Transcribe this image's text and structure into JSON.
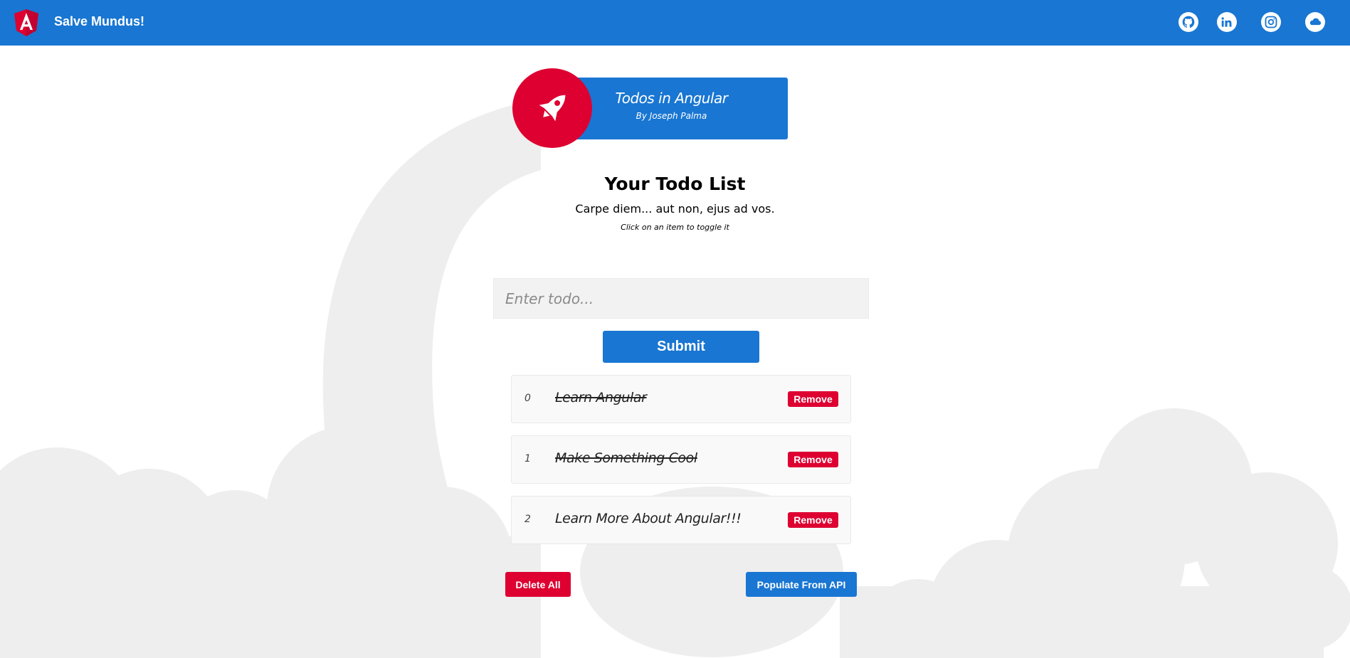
{
  "header": {
    "app_title": "Salve Mundus!",
    "brand_color": "#1976d2",
    "social_links": [
      {
        "name": "github-icon"
      },
      {
        "name": "linkedin-icon"
      },
      {
        "name": "instagram-icon"
      },
      {
        "name": "soundcloud-icon"
      }
    ]
  },
  "banner": {
    "title": "Todos in Angular",
    "subtitle": "By Joseph Palma",
    "icon": "rocket-icon",
    "accent_color": "#dd0031"
  },
  "main": {
    "heading": "Your Todo List",
    "tagline": "Carpe diem... aut non, ejus ad vos.",
    "hint": "Click on an item to toggle it"
  },
  "form": {
    "placeholder": "Enter todo...",
    "value": "",
    "submit_label": "Submit"
  },
  "todos": [
    {
      "index": "0",
      "text": "Learn Angular",
      "completed": true,
      "remove_label": "Remove"
    },
    {
      "index": "1",
      "text": "Make Something Cool",
      "completed": true,
      "remove_label": "Remove"
    },
    {
      "index": "2",
      "text": "Learn More About Angular!!!",
      "completed": false,
      "remove_label": "Remove"
    }
  ],
  "actions": {
    "delete_all_label": "Delete All",
    "populate_label": "Populate From API"
  }
}
